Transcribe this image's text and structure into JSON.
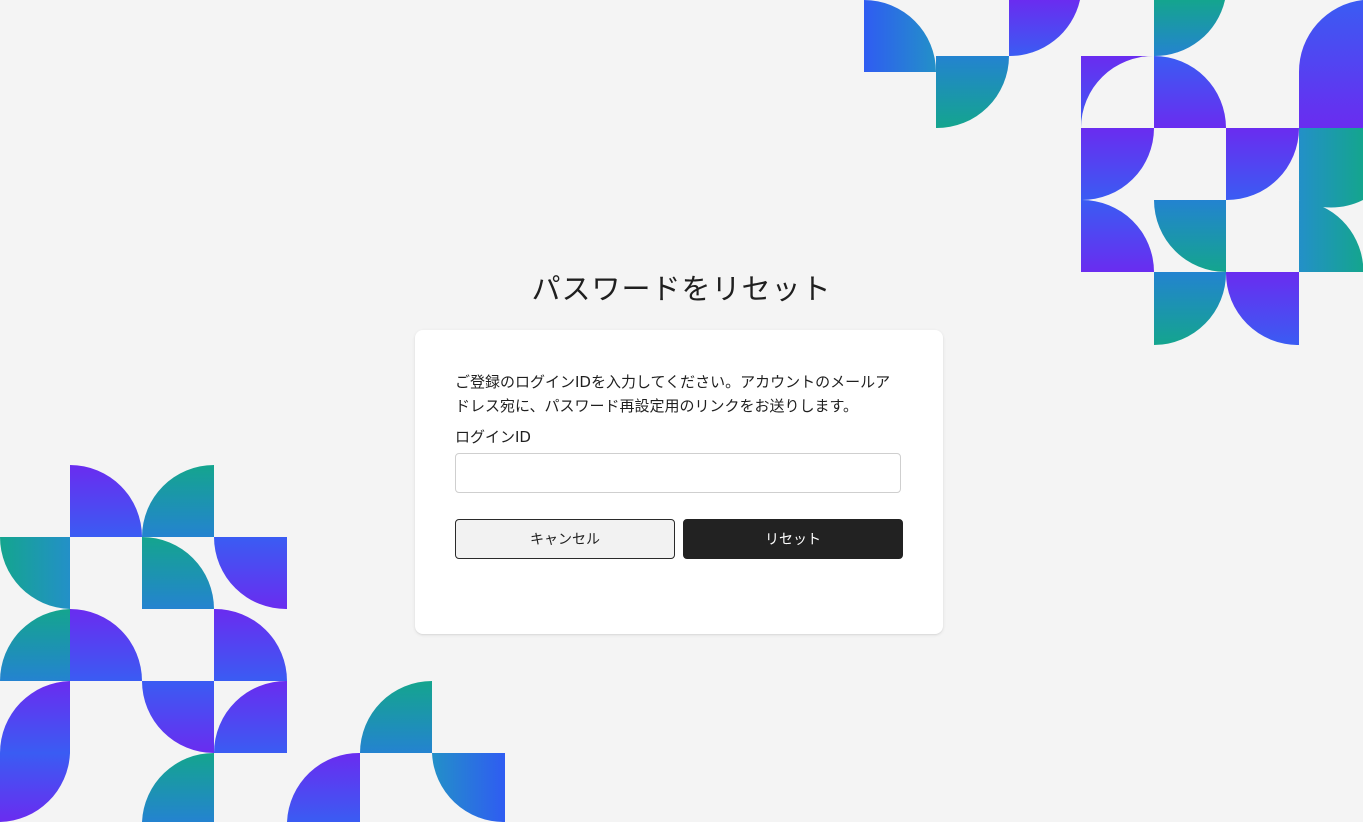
{
  "page": {
    "title": "パスワードをリセット"
  },
  "card": {
    "description": "ご登録のログインIDを入力してください。アカウントのメールアドレス宛に、パスワード再設定用のリンクをお送りします。",
    "login_id_label": "ログインID",
    "login_id_value": "",
    "login_id_placeholder": ""
  },
  "actions": {
    "cancel_label": "キャンセル",
    "reset_label": "リセット"
  },
  "theme": {
    "background": "#f4f4f4",
    "card_background": "#ffffff",
    "primary_button": "#222222",
    "decoration_colors": [
      "#6a2cf0",
      "#2f5cf2",
      "#2390c8",
      "#14a58e"
    ]
  },
  "decorations": {
    "icon": "geometric-quarter-circle-pattern"
  }
}
